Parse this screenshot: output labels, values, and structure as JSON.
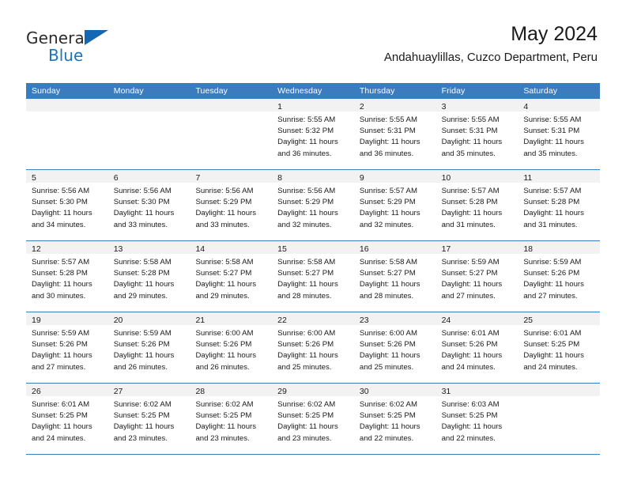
{
  "brand": {
    "name_top": "General",
    "name_bottom": "Blue",
    "accent_color": "#1b75bc",
    "triangle_color": "#1667b1",
    "logo_icon": "triangle-icon"
  },
  "header": {
    "title": "May 2024",
    "subtitle": "Andahuaylillas, Cuzco Department, Peru"
  },
  "calendar": {
    "header_bg": "#3a7cbe",
    "header_text_color": "#ffffff",
    "day_band_bg": "#f2f2f2",
    "weekdays": [
      "Sunday",
      "Monday",
      "Tuesday",
      "Wednesday",
      "Thursday",
      "Friday",
      "Saturday"
    ],
    "labels": {
      "sunrise": "Sunrise:",
      "sunset": "Sunset:",
      "daylight": "Daylight:"
    },
    "weeks": [
      [
        {
          "day": "",
          "empty": true
        },
        {
          "day": "",
          "empty": true
        },
        {
          "day": "",
          "empty": true
        },
        {
          "day": "1",
          "sunrise": "Sunrise: 5:55 AM",
          "sunset": "Sunset: 5:32 PM",
          "daylight_1": "Daylight: 11 hours",
          "daylight_2": "and 36 minutes."
        },
        {
          "day": "2",
          "sunrise": "Sunrise: 5:55 AM",
          "sunset": "Sunset: 5:31 PM",
          "daylight_1": "Daylight: 11 hours",
          "daylight_2": "and 36 minutes."
        },
        {
          "day": "3",
          "sunrise": "Sunrise: 5:55 AM",
          "sunset": "Sunset: 5:31 PM",
          "daylight_1": "Daylight: 11 hours",
          "daylight_2": "and 35 minutes."
        },
        {
          "day": "4",
          "sunrise": "Sunrise: 5:55 AM",
          "sunset": "Sunset: 5:31 PM",
          "daylight_1": "Daylight: 11 hours",
          "daylight_2": "and 35 minutes."
        }
      ],
      [
        {
          "day": "5",
          "sunrise": "Sunrise: 5:56 AM",
          "sunset": "Sunset: 5:30 PM",
          "daylight_1": "Daylight: 11 hours",
          "daylight_2": "and 34 minutes."
        },
        {
          "day": "6",
          "sunrise": "Sunrise: 5:56 AM",
          "sunset": "Sunset: 5:30 PM",
          "daylight_1": "Daylight: 11 hours",
          "daylight_2": "and 33 minutes."
        },
        {
          "day": "7",
          "sunrise": "Sunrise: 5:56 AM",
          "sunset": "Sunset: 5:29 PM",
          "daylight_1": "Daylight: 11 hours",
          "daylight_2": "and 33 minutes."
        },
        {
          "day": "8",
          "sunrise": "Sunrise: 5:56 AM",
          "sunset": "Sunset: 5:29 PM",
          "daylight_1": "Daylight: 11 hours",
          "daylight_2": "and 32 minutes."
        },
        {
          "day": "9",
          "sunrise": "Sunrise: 5:57 AM",
          "sunset": "Sunset: 5:29 PM",
          "daylight_1": "Daylight: 11 hours",
          "daylight_2": "and 32 minutes."
        },
        {
          "day": "10",
          "sunrise": "Sunrise: 5:57 AM",
          "sunset": "Sunset: 5:28 PM",
          "daylight_1": "Daylight: 11 hours",
          "daylight_2": "and 31 minutes."
        },
        {
          "day": "11",
          "sunrise": "Sunrise: 5:57 AM",
          "sunset": "Sunset: 5:28 PM",
          "daylight_1": "Daylight: 11 hours",
          "daylight_2": "and 31 minutes."
        }
      ],
      [
        {
          "day": "12",
          "sunrise": "Sunrise: 5:57 AM",
          "sunset": "Sunset: 5:28 PM",
          "daylight_1": "Daylight: 11 hours",
          "daylight_2": "and 30 minutes."
        },
        {
          "day": "13",
          "sunrise": "Sunrise: 5:58 AM",
          "sunset": "Sunset: 5:28 PM",
          "daylight_1": "Daylight: 11 hours",
          "daylight_2": "and 29 minutes."
        },
        {
          "day": "14",
          "sunrise": "Sunrise: 5:58 AM",
          "sunset": "Sunset: 5:27 PM",
          "daylight_1": "Daylight: 11 hours",
          "daylight_2": "and 29 minutes."
        },
        {
          "day": "15",
          "sunrise": "Sunrise: 5:58 AM",
          "sunset": "Sunset: 5:27 PM",
          "daylight_1": "Daylight: 11 hours",
          "daylight_2": "and 28 minutes."
        },
        {
          "day": "16",
          "sunrise": "Sunrise: 5:58 AM",
          "sunset": "Sunset: 5:27 PM",
          "daylight_1": "Daylight: 11 hours",
          "daylight_2": "and 28 minutes."
        },
        {
          "day": "17",
          "sunrise": "Sunrise: 5:59 AM",
          "sunset": "Sunset: 5:27 PM",
          "daylight_1": "Daylight: 11 hours",
          "daylight_2": "and 27 minutes."
        },
        {
          "day": "18",
          "sunrise": "Sunrise: 5:59 AM",
          "sunset": "Sunset: 5:26 PM",
          "daylight_1": "Daylight: 11 hours",
          "daylight_2": "and 27 minutes."
        }
      ],
      [
        {
          "day": "19",
          "sunrise": "Sunrise: 5:59 AM",
          "sunset": "Sunset: 5:26 PM",
          "daylight_1": "Daylight: 11 hours",
          "daylight_2": "and 27 minutes."
        },
        {
          "day": "20",
          "sunrise": "Sunrise: 5:59 AM",
          "sunset": "Sunset: 5:26 PM",
          "daylight_1": "Daylight: 11 hours",
          "daylight_2": "and 26 minutes."
        },
        {
          "day": "21",
          "sunrise": "Sunrise: 6:00 AM",
          "sunset": "Sunset: 5:26 PM",
          "daylight_1": "Daylight: 11 hours",
          "daylight_2": "and 26 minutes."
        },
        {
          "day": "22",
          "sunrise": "Sunrise: 6:00 AM",
          "sunset": "Sunset: 5:26 PM",
          "daylight_1": "Daylight: 11 hours",
          "daylight_2": "and 25 minutes."
        },
        {
          "day": "23",
          "sunrise": "Sunrise: 6:00 AM",
          "sunset": "Sunset: 5:26 PM",
          "daylight_1": "Daylight: 11 hours",
          "daylight_2": "and 25 minutes."
        },
        {
          "day": "24",
          "sunrise": "Sunrise: 6:01 AM",
          "sunset": "Sunset: 5:26 PM",
          "daylight_1": "Daylight: 11 hours",
          "daylight_2": "and 24 minutes."
        },
        {
          "day": "25",
          "sunrise": "Sunrise: 6:01 AM",
          "sunset": "Sunset: 5:25 PM",
          "daylight_1": "Daylight: 11 hours",
          "daylight_2": "and 24 minutes."
        }
      ],
      [
        {
          "day": "26",
          "sunrise": "Sunrise: 6:01 AM",
          "sunset": "Sunset: 5:25 PM",
          "daylight_1": "Daylight: 11 hours",
          "daylight_2": "and 24 minutes."
        },
        {
          "day": "27",
          "sunrise": "Sunrise: 6:02 AM",
          "sunset": "Sunset: 5:25 PM",
          "daylight_1": "Daylight: 11 hours",
          "daylight_2": "and 23 minutes."
        },
        {
          "day": "28",
          "sunrise": "Sunrise: 6:02 AM",
          "sunset": "Sunset: 5:25 PM",
          "daylight_1": "Daylight: 11 hours",
          "daylight_2": "and 23 minutes."
        },
        {
          "day": "29",
          "sunrise": "Sunrise: 6:02 AM",
          "sunset": "Sunset: 5:25 PM",
          "daylight_1": "Daylight: 11 hours",
          "daylight_2": "and 23 minutes."
        },
        {
          "day": "30",
          "sunrise": "Sunrise: 6:02 AM",
          "sunset": "Sunset: 5:25 PM",
          "daylight_1": "Daylight: 11 hours",
          "daylight_2": "and 22 minutes."
        },
        {
          "day": "31",
          "sunrise": "Sunrise: 6:03 AM",
          "sunset": "Sunset: 5:25 PM",
          "daylight_1": "Daylight: 11 hours",
          "daylight_2": "and 22 minutes."
        },
        {
          "day": "",
          "empty": true
        }
      ]
    ]
  }
}
